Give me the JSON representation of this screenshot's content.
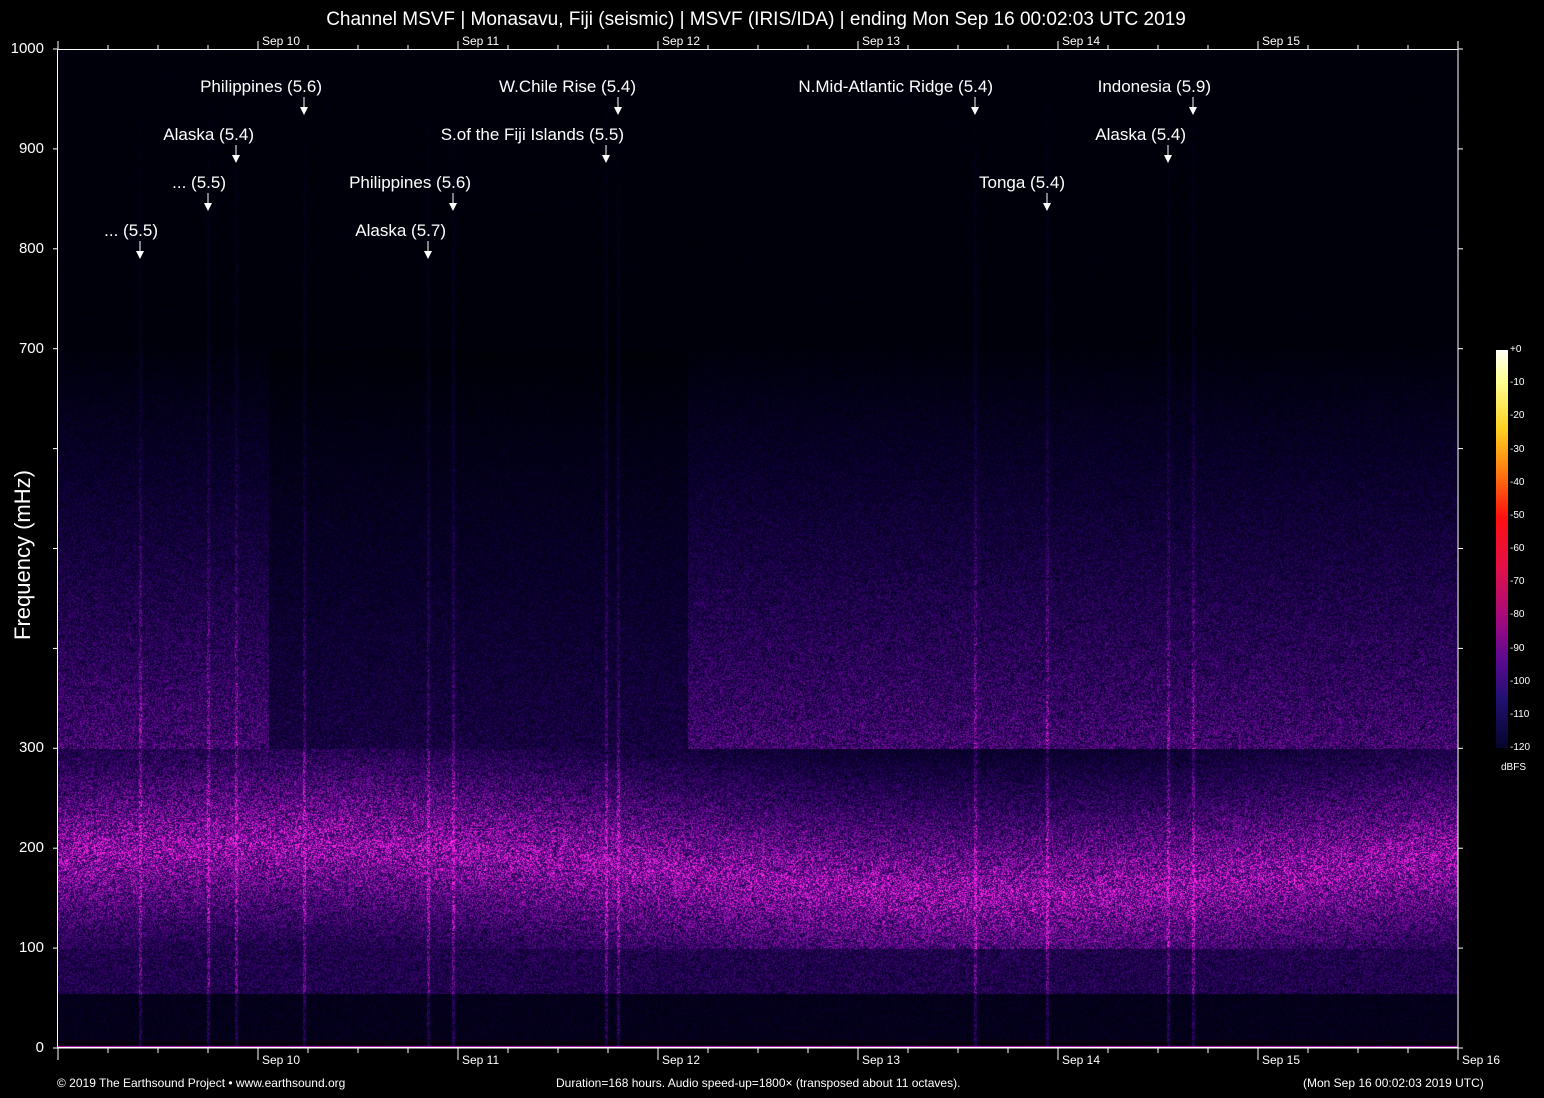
{
  "chart_data": {
    "type": "heatmap",
    "title": "Channel MSVF | Monasavu, Fiji (seismic) | MSVF (IRIS/IDA) | ending Mon Sep 16 00:02:03 UTC 2019",
    "ylabel": "Frequency (mHz)",
    "ylim": [
      0,
      1000
    ],
    "y_ticks": [
      0,
      100,
      200,
      300,
      400,
      500,
      600,
      700,
      800,
      900,
      1000
    ],
    "y_tick_labels": [
      "0",
      "100",
      "200",
      "300",
      "",
      "",
      "",
      "700",
      "800",
      "900",
      "1000"
    ],
    "x_unit": "days since Sep 9 00:02 UTC",
    "xlim": [
      0,
      7
    ],
    "x_ticks": [
      1,
      2,
      3,
      4,
      5,
      6,
      7
    ],
    "x_tick_labels": [
      "Sep 10",
      "Sep 11",
      "Sep 12",
      "Sep 13",
      "Sep 14",
      "Sep 15",
      "Sep 16"
    ],
    "colorbar": {
      "label": "dBFS",
      "range": [
        -120,
        0
      ],
      "tick_labels": [
        "+0",
        "-10",
        "-20",
        "-30",
        "-40",
        "-50",
        "-60",
        "-70",
        "-80",
        "-90",
        "-100",
        "-110",
        "-120"
      ]
    },
    "events": [
      {
        "label": "... (5.5)",
        "day": 0.41
      },
      {
        "label": "... (5.5)",
        "day": 0.75
      },
      {
        "label": "Alaska (5.4)",
        "day": 0.89
      },
      {
        "label": "Philippines (5.6)",
        "day": 1.23
      },
      {
        "label": "Alaska (5.7)",
        "day": 1.85
      },
      {
        "label": "Philippines (5.6)",
        "day": 1.975
      },
      {
        "label": "S.of the Fiji Islands (5.5)",
        "day": 2.74
      },
      {
        "label": "W.Chile Rise (5.4)",
        "day": 2.8
      },
      {
        "label": "N.Mid-Atlantic Ridge (5.4)",
        "day": 4.585
      },
      {
        "label": "Tonga (5.4)",
        "day": 4.945
      },
      {
        "label": "Alaska (5.4)",
        "day": 5.55
      },
      {
        "label": "Indonesia (5.9)",
        "day": 5.675
      }
    ]
  },
  "footer": {
    "copyright": "© 2019 The Earthsound Project • www.earthsound.org",
    "info": "Duration=168 hours. Audio speed-up=1800× (transposed about 11 octaves).",
    "end_time": "(Mon Sep 16 00:02:03 2019 UTC)"
  },
  "colors": {
    "band": "#a0189a",
    "axis": "#ffffff"
  }
}
